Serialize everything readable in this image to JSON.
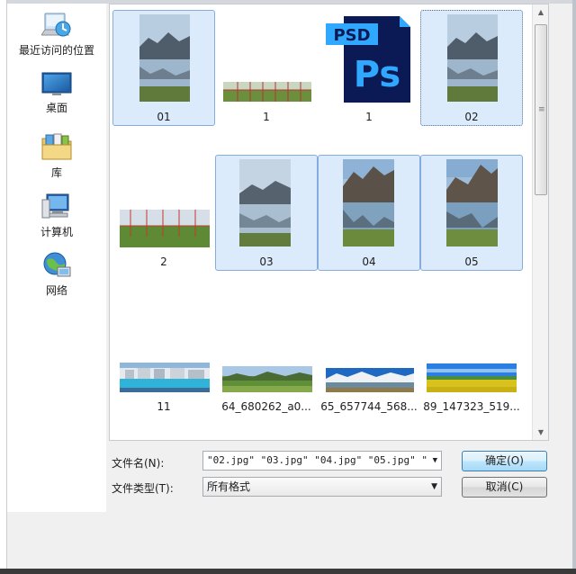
{
  "places": [
    {
      "label": "最近访问的位置",
      "icon": "recent-places-icon"
    },
    {
      "label": "桌面",
      "icon": "desktop-icon"
    },
    {
      "label": "库",
      "icon": "libraries-icon"
    },
    {
      "label": "计算机",
      "icon": "computer-icon"
    },
    {
      "label": "网络",
      "icon": "network-icon"
    }
  ],
  "files": [
    {
      "label": "01",
      "kind": "portrait-lake",
      "selected": true
    },
    {
      "label": "1",
      "kind": "panorama-grid"
    },
    {
      "label": "1",
      "kind": "psd-file",
      "badge": "PSD",
      "letters": "Ps"
    },
    {
      "label": "02",
      "kind": "portrait-lake",
      "selected": true,
      "focused": true
    },
    {
      "label": "2",
      "kind": "wide-grid"
    },
    {
      "label": "03",
      "kind": "portrait-lake",
      "selected": true
    },
    {
      "label": "04",
      "kind": "portrait-mountain",
      "selected": true
    },
    {
      "label": "05",
      "kind": "portrait-mountain",
      "selected": true
    },
    {
      "label": "11",
      "kind": "panorama-pool"
    },
    {
      "label": "64_680262_a0...",
      "kind": "panorama-green"
    },
    {
      "label": "65_657744_568...",
      "kind": "panorama-mountain"
    },
    {
      "label": "89_147323_519...",
      "kind": "panorama-yellow"
    }
  ],
  "filename": {
    "label": "文件名(N):",
    "value": "\"02.jpg\" \"03.jpg\" \"04.jpg\" \"05.jpg\" \""
  },
  "filetype": {
    "label": "文件类型(T):",
    "value": "所有格式"
  },
  "buttons": {
    "ok": "确定(O)",
    "cancel": "取消(C)"
  },
  "colors": {
    "selection_bg": "#dcebfc",
    "selection_border": "#84acdd",
    "psd_blue": "#0b1a55",
    "psd_accent": "#31a8ff"
  }
}
